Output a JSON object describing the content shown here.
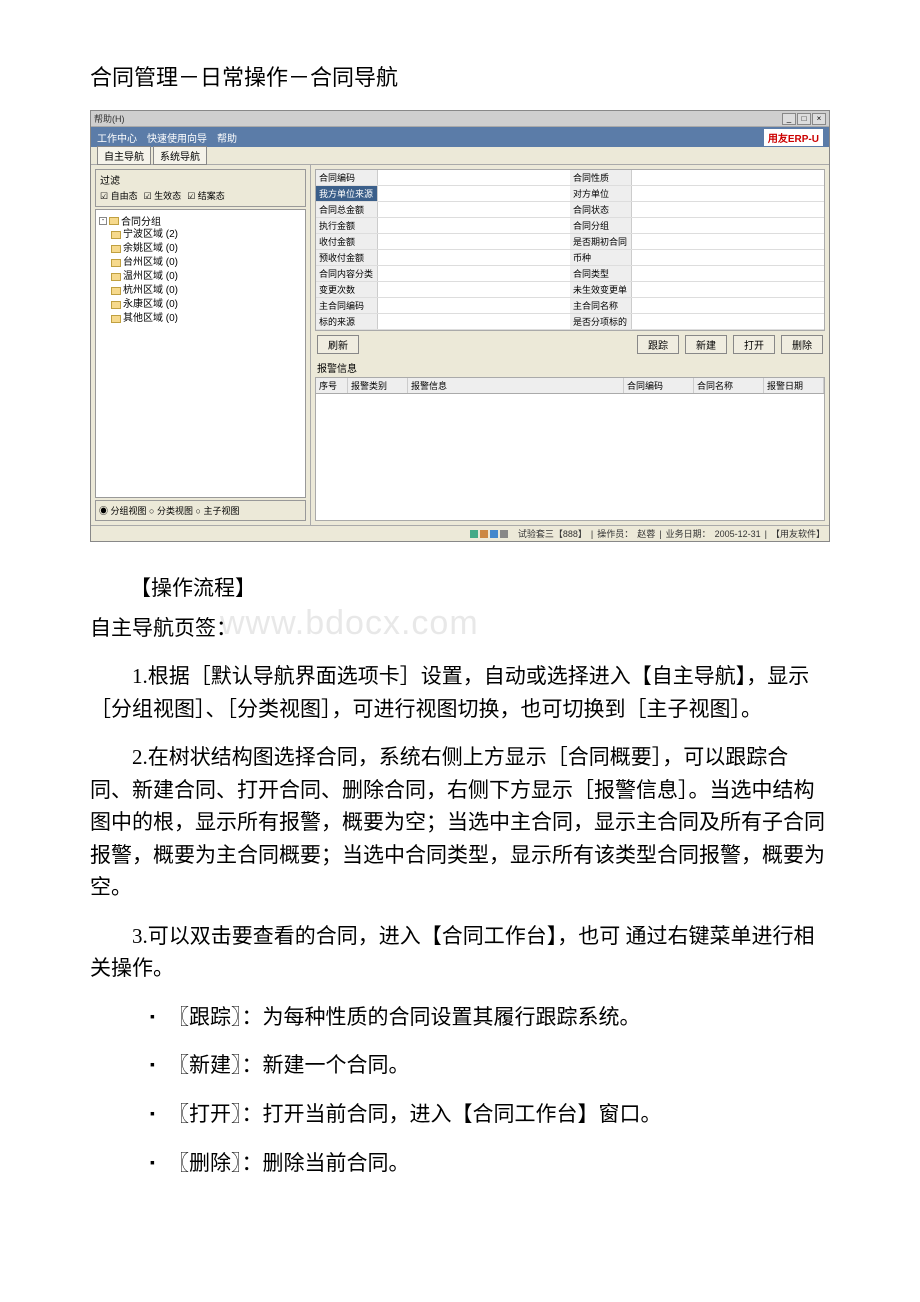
{
  "page_title": "合同管理－日常操作－合同导航",
  "screenshot": {
    "window_title": "帮助(H)",
    "toolbar": {
      "work_center": "工作中心",
      "wizard": "快速使用向导",
      "help": "帮助",
      "logo": "用友ERP-"
    },
    "nav_tabs": {
      "tab1": "自主导航",
      "tab2": "系统导航"
    },
    "filter": {
      "title": "过滤",
      "opt1": "自由态",
      "opt2": "生效态",
      "opt3": "结案态"
    },
    "tree": {
      "root": "合同分组",
      "items": [
        "宁波区域 (2)",
        "余姚区域 (0)",
        "台州区域 (0)",
        "温州区域 (0)",
        "杭州区域 (0)",
        "永康区域 (0)",
        "其他区域 (0)"
      ]
    },
    "view_radios": {
      "r1": "分组视图",
      "r2": "分类视图",
      "r3": "主子视图"
    },
    "fields": {
      "left": [
        "合同编码",
        "我方单位来源",
        "合同总金额",
        "执行金额",
        "收付金额",
        "预收付金额",
        "合同内容分类",
        "变更次数",
        "主合同编码",
        "标的来源"
      ],
      "right": [
        "合同性质",
        "对方单位",
        "合同状态",
        "合同分组",
        "是否期初合同",
        "币种",
        "合同类型",
        "未生效变更单",
        "主合同名称",
        "是否分项标的"
      ]
    },
    "buttons": {
      "refresh": "刷新",
      "track": "跟踪",
      "new": "新建",
      "open": "打开",
      "delete": "删除"
    },
    "alert_section": "报警信息",
    "alert_cols": [
      "序号",
      "报警类别",
      "报警信息",
      "合同编码",
      "合同名称",
      "报警日期"
    ],
    "statusbar": {
      "account": "试验套三【888】",
      "operator_label": "操作员：",
      "operator": "赵蓉",
      "date_label": "业务日期：",
      "date": "2005-12-31",
      "company": "【用友软件】"
    }
  },
  "doc": {
    "heading": "【操作流程】",
    "subhead": "自主导航页签：",
    "watermark": "www.bdocx.com",
    "p1": "1.根据［默认导航界面选项卡］设置，自动或选择进入【自主导航】，显示［分组视图］、［分类视图］，可进行视图切换，也可切换到［主子视图］。",
    "p2": "2.在树状结构图选择合同，系统右侧上方显示［合同概要］，可以跟踪合同、新建合同、打开合同、删除合同，右侧下方显示［报警信息］。当选中结构图中的根，显示所有报警，概要为空；当选中主合同，显示主合同及所有子合同报警，概要为主合同概要；当选中合同类型，显示所有该类型合同报警，概要为空。",
    "p3": "3.可以双击要查看的合同，进入【合同工作台】，也可 通过右键菜单进行相关操作。",
    "bullets": [
      "〖跟踪〗：为每种性质的合同设置其履行跟踪系统。",
      "〖新建〗：新建一个合同。",
      "〖打开〗：打开当前合同，进入【合同工作台】窗口。",
      "〖删除〗：删除当前合同。"
    ]
  }
}
